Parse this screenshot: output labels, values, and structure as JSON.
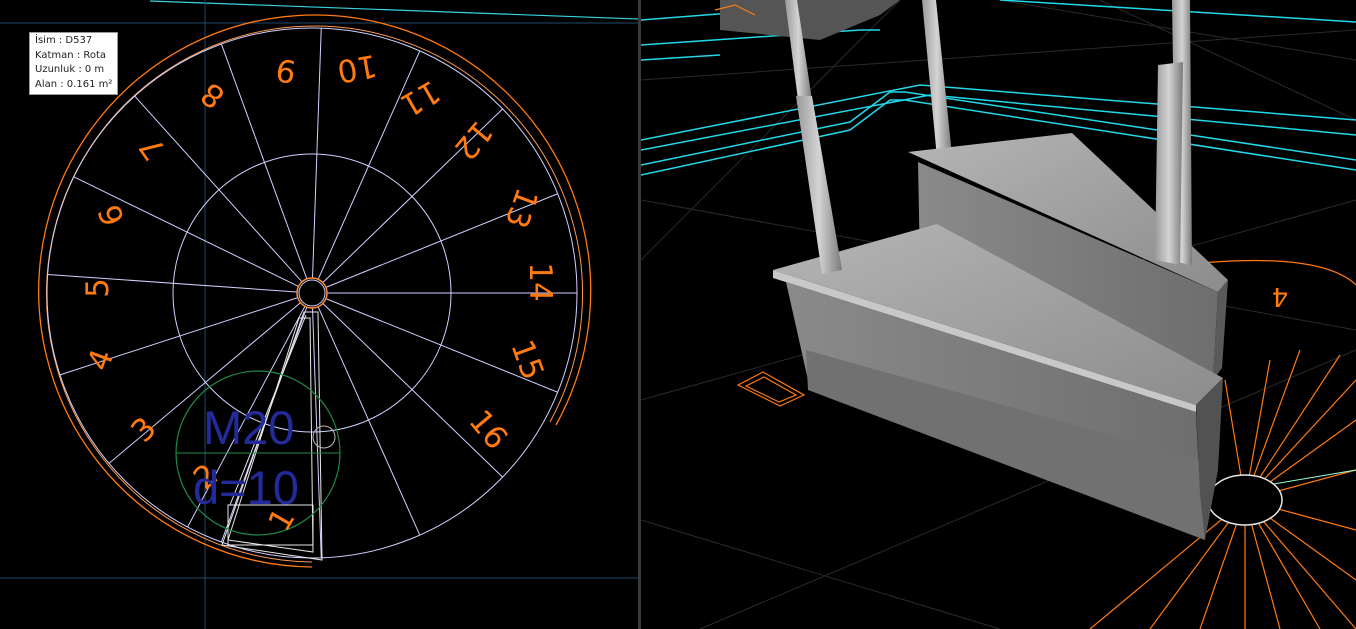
{
  "plan_view": {
    "tooltip": {
      "isim": "İsim : D537",
      "katman": "Katman : Rota",
      "uzunluk": "Uzunluk : 0 m",
      "alan": "Alan : 0.161 m²"
    },
    "step_numbers": [
      "1",
      "2",
      "3",
      "4",
      "5",
      "6",
      "7",
      "8",
      "9",
      "10",
      "11",
      "12",
      "13",
      "14",
      "15",
      "16"
    ],
    "route_label_top": "M20",
    "route_label_bottom": "d=10",
    "colors": {
      "step_number": "#ff7a10",
      "tread_line": "#d0d0ff",
      "route": "#232b9a",
      "grid": "#38d4e0",
      "boundary": "#ff7a10"
    }
  },
  "view3d": {
    "visible_step_number": "4",
    "colors": {
      "cad_line": "#22d8e8",
      "orange_line": "#ff7a10",
      "concrete": "#8e8e8e"
    }
  }
}
